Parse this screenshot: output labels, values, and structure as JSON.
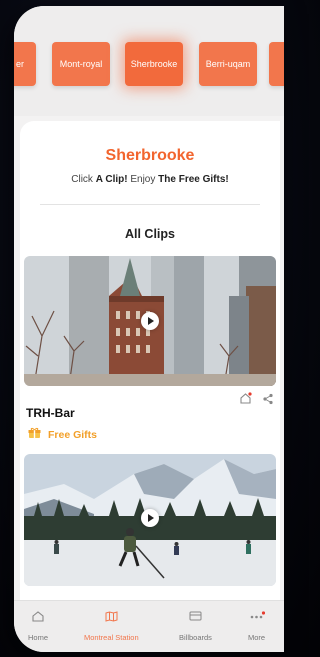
{
  "stations": [
    {
      "label": "er",
      "active": false
    },
    {
      "label": "Mont-royal",
      "active": false
    },
    {
      "label": "Sherbrooke",
      "active": true
    },
    {
      "label": "Berri-uqam",
      "active": false
    },
    {
      "label": "",
      "active": false
    }
  ],
  "header": {
    "title": "Sherbrooke",
    "subtitle_lead": "Click ",
    "subtitle_bold1": "A Clip!",
    "subtitle_mid": " Enjoy ",
    "subtitle_bold2": "The Free Gifts!"
  },
  "section_title": "All Clips",
  "clips": [
    {
      "name": "TRH-Bar",
      "gift_label": "Free Gifts"
    }
  ],
  "tabs": [
    {
      "label": "Home",
      "icon": "home-icon"
    },
    {
      "label": "Montreal Station",
      "icon": "map-icon"
    },
    {
      "label": "Billboards",
      "icon": "billboard-icon"
    },
    {
      "label": "More",
      "icon": "more-icon"
    }
  ],
  "colors": {
    "accent": "#f2652e",
    "chip": "#f2764c",
    "gift": "#f2a02a",
    "notify": "#e63b2e"
  }
}
